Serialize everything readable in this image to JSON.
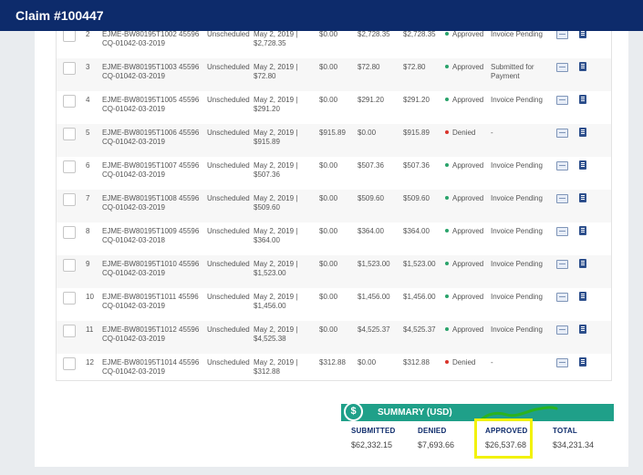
{
  "header": {
    "title": "Claim #100447"
  },
  "rows": [
    {
      "num": "2",
      "id": "EJME-BW80195T1002 45596 CQ-01042-03-2019",
      "type": "Unscheduled",
      "date": "May 2, 2019 | $2,728.35",
      "a1": "$0.00",
      "a2": "$2,728.35",
      "a3": "$2,728.35",
      "status": "Approved",
      "status_color": "#2aa36b",
      "invoice": "Invoice Pending"
    },
    {
      "num": "3",
      "id": "EJME-BW80195T1003 45596 CQ-01042-03-2019",
      "type": "Unscheduled",
      "date": "May 2, 2019 | $72.80",
      "a1": "$0.00",
      "a2": "$72.80",
      "a3": "$72.80",
      "status": "Approved",
      "status_color": "#2aa36b",
      "invoice": "Submitted for Payment"
    },
    {
      "num": "4",
      "id": "EJME-BW80195T1005 45596 CQ-01042-03-2019",
      "type": "Unscheduled",
      "date": "May 2, 2019 | $291.20",
      "a1": "$0.00",
      "a2": "$291.20",
      "a3": "$291.20",
      "status": "Approved",
      "status_color": "#2aa36b",
      "invoice": "Invoice Pending"
    },
    {
      "num": "5",
      "id": "EJME-BW80195T1006 45596 CQ-01042-03-2019",
      "type": "Unscheduled",
      "date": "May 2, 2019 | $915.89",
      "a1": "$915.89",
      "a2": "$0.00",
      "a3": "$915.89",
      "status": "Denied",
      "status_color": "#d9342b",
      "invoice": "-"
    },
    {
      "num": "6",
      "id": "EJME-BW80195T1007 45596 CQ-01042-03-2019",
      "type": "Unscheduled",
      "date": "May 2, 2019 | $507.36",
      "a1": "$0.00",
      "a2": "$507.36",
      "a3": "$507.36",
      "status": "Approved",
      "status_color": "#2aa36b",
      "invoice": "Invoice Pending"
    },
    {
      "num": "7",
      "id": "EJME-BW80195T1008 45596 CQ-01042-03-2019",
      "type": "Unscheduled",
      "date": "May 2, 2019 | $509.60",
      "a1": "$0.00",
      "a2": "$509.60",
      "a3": "$509.60",
      "status": "Approved",
      "status_color": "#2aa36b",
      "invoice": "Invoice Pending"
    },
    {
      "num": "8",
      "id": "EJME-BW80195T1009 45596 CQ-01042-03-2018",
      "type": "Unscheduled",
      "date": "May 2, 2019 | $364.00",
      "a1": "$0.00",
      "a2": "$364.00",
      "a3": "$364.00",
      "status": "Approved",
      "status_color": "#2aa36b",
      "invoice": "Invoice Pending"
    },
    {
      "num": "9",
      "id": "EJME-BW80195T1010 45596 CQ-01042-03-2019",
      "type": "Unscheduled",
      "date": "May 2, 2019 | $1,523.00",
      "a1": "$0.00",
      "a2": "$1,523.00",
      "a3": "$1,523.00",
      "status": "Approved",
      "status_color": "#2aa36b",
      "invoice": "Invoice Pending"
    },
    {
      "num": "10",
      "id": "EJME-BW80195T1011 45596 CQ-01042-03-2019",
      "type": "Unscheduled",
      "date": "May 2, 2019 | $1,456.00",
      "a1": "$0.00",
      "a2": "$1,456.00",
      "a3": "$1,456.00",
      "status": "Approved",
      "status_color": "#2aa36b",
      "invoice": "Invoice Pending"
    },
    {
      "num": "11",
      "id": "EJME-BW80195T1012 45596 CQ-01042-03-2019",
      "type": "Unscheduled",
      "date": "May 2, 2019 | $4,525.38",
      "a1": "$0.00",
      "a2": "$4,525.37",
      "a3": "$4,525.37",
      "status": "Approved",
      "status_color": "#2aa36b",
      "invoice": "Invoice Pending"
    },
    {
      "num": "12",
      "id": "EJME-BW80195T1014 45596 CQ-01042-03-2019",
      "type": "Unscheduled",
      "date": "May 2, 2019 | $312.88",
      "a1": "$312.88",
      "a2": "$0.00",
      "a3": "$312.88",
      "status": "Denied",
      "status_color": "#d9342b",
      "invoice": "-"
    }
  ],
  "summary": {
    "icon_glyph": "$",
    "title": "SUMMARY (USD)",
    "submitted_label": "SUBMITTED",
    "submitted_value": "$62,332.15",
    "denied_label": "DENIED",
    "denied_value": "$7,693.66",
    "approved_label": "APPROVED",
    "approved_value": "$26,537.68",
    "total_label": "TOTAL",
    "total_value": "$34,231.34"
  }
}
